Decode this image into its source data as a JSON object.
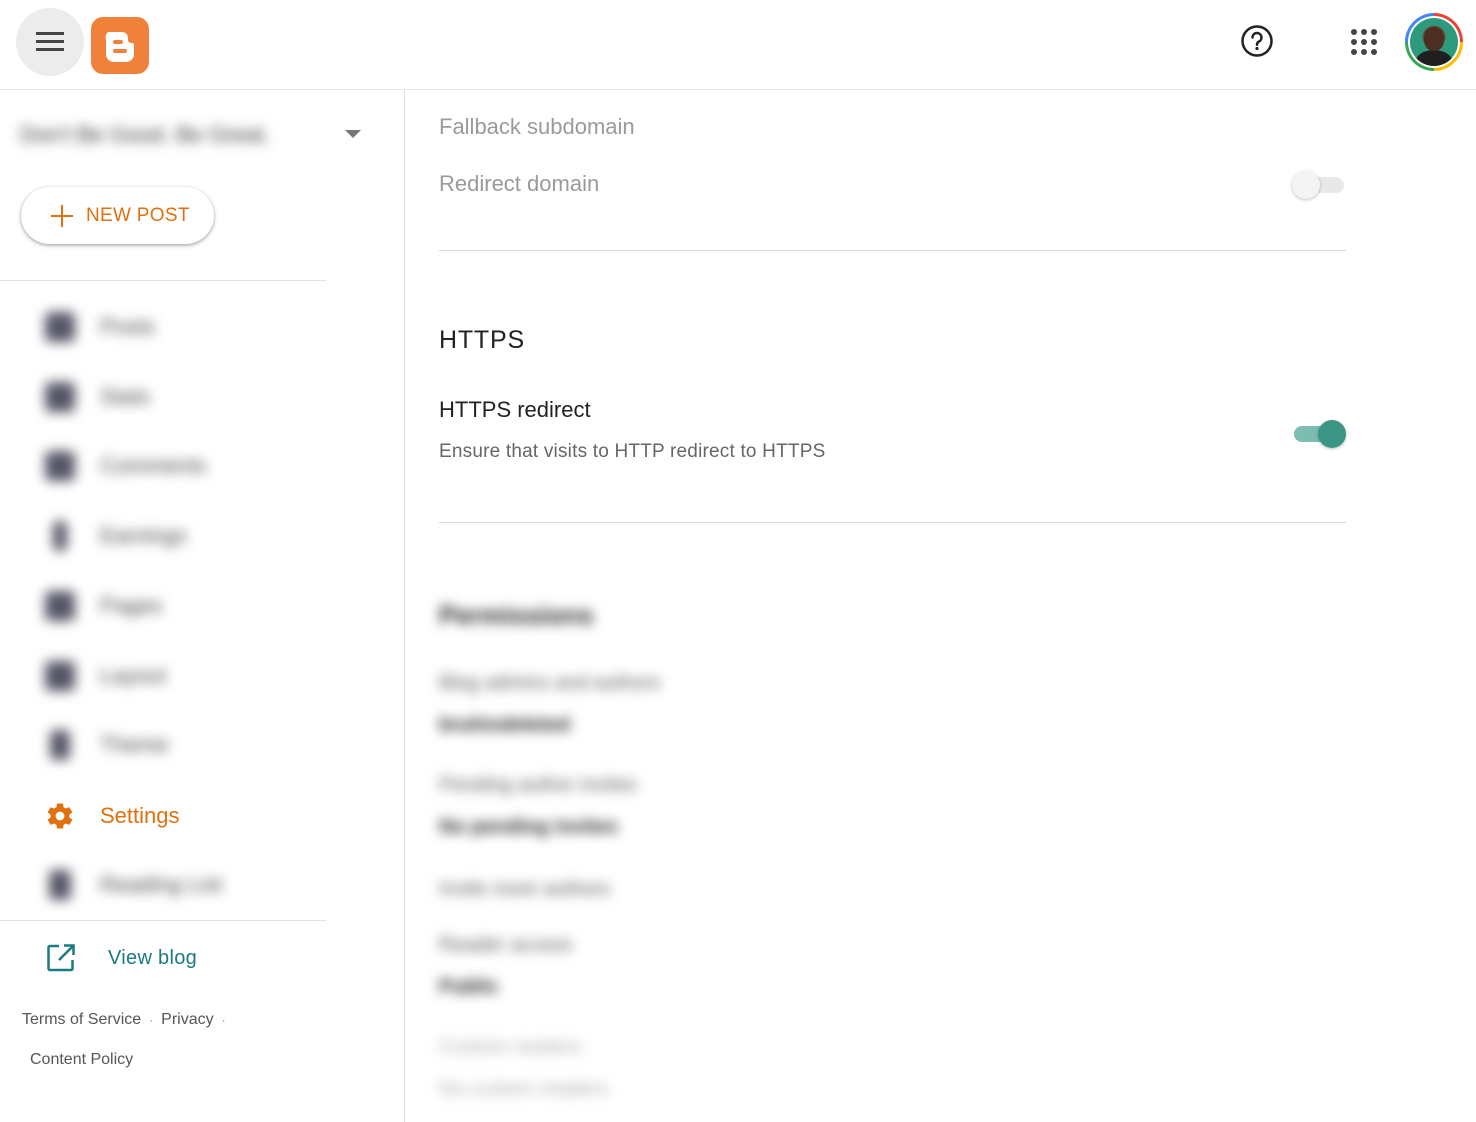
{
  "header": {
    "menu_icon": "hamburger-menu-icon",
    "logo_icon": "blogger-logo-icon",
    "help_icon": "help-circle-icon",
    "apps_icon": "apps-grid-icon",
    "avatar_icon": "user-avatar",
    "brand_color": "#f0813b"
  },
  "sidebar": {
    "blog_name": "Don't Be Good. Be Great.",
    "new_post_label": "NEW POST",
    "items": [
      {
        "label": "Posts",
        "icon": "posts-icon",
        "blurred": true
      },
      {
        "label": "Stats",
        "icon": "stats-icon",
        "blurred": true
      },
      {
        "label": "Comments",
        "icon": "comments-icon",
        "blurred": true
      },
      {
        "label": "Earnings",
        "icon": "earnings-icon",
        "blurred": true
      },
      {
        "label": "Pages",
        "icon": "pages-icon",
        "blurred": true
      },
      {
        "label": "Layout",
        "icon": "layout-icon",
        "blurred": true
      },
      {
        "label": "Theme",
        "icon": "theme-icon",
        "blurred": true
      },
      {
        "label": "Settings",
        "icon": "gear-icon",
        "blurred": false,
        "active": true
      },
      {
        "label": "Reading List",
        "icon": "reading-list-icon",
        "blurred": true
      }
    ],
    "view_blog_label": "View blog",
    "footer": {
      "terms": "Terms of Service",
      "privacy": "Privacy",
      "content_policy": "Content Policy"
    },
    "accent_color": "#e2700f",
    "link_color": "#1c7a82"
  },
  "main": {
    "fallback_subdomain_label": "Fallback subdomain",
    "redirect_domain": {
      "label": "Redirect domain",
      "enabled": false
    },
    "https_section": {
      "title": "HTTPS",
      "redirect": {
        "title": "HTTPS redirect",
        "description": "Ensure that visits to HTTP redirect to HTTPS",
        "enabled": true
      }
    },
    "permissions_section": {
      "title": "Permissions",
      "blog_admins_label": "Blog admins and authors",
      "blog_admins_value": "bruhisdeleted",
      "pending_invites_label": "Pending author invites",
      "pending_invites_value": "No pending invites",
      "invite_label": "Invite more authors",
      "reader_access_label": "Reader access",
      "reader_access_value": "Public",
      "custom_readers_label": "Custom readers",
      "custom_readers_value": "No custom readers"
    },
    "toggle_on_color": "#3a9584"
  }
}
